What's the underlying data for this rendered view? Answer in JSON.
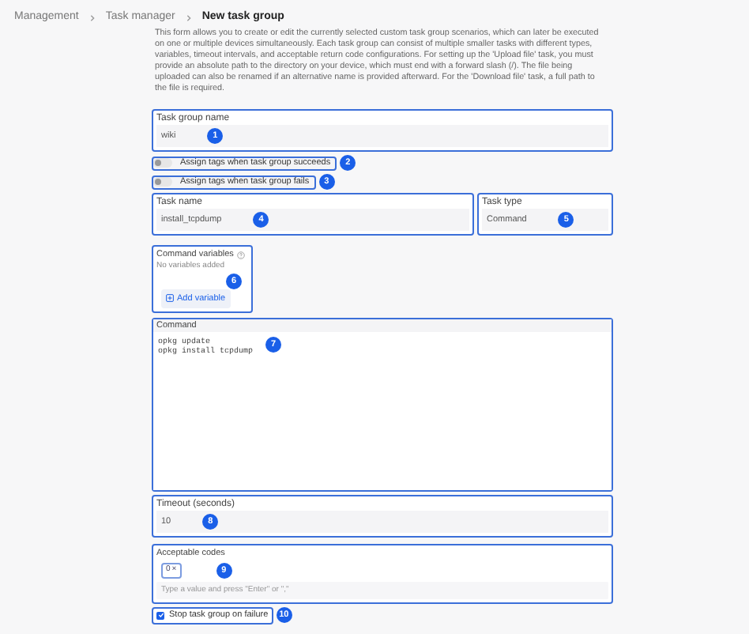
{
  "breadcrumb": [
    {
      "label": "Management",
      "current": false
    },
    {
      "label": "Task manager",
      "current": false
    },
    {
      "label": "New task group",
      "current": true
    }
  ],
  "description": "This form allows you to create or edit the currently selected custom task group scenarios, which can later be executed on one or multiple devices simultaneously. Each task group can consist of multiple smaller tasks with different types, variables, timeout intervals, and acceptable return code configurations. For setting up the 'Upload file' task, you must provide an absolute path to the directory on your device, which must end with a forward slash (/). The file being uploaded can also be renamed if an alternative name is provided afterward. For the 'Download file' task, a full path to the file is required.",
  "rows": [
    [
      {
        "kind": "text",
        "label": "Task group name",
        "value": "wiki",
        "marker": "1"
      }
    ],
    [
      {
        "kind": "toggle",
        "label": "Assign tags when task group succeeds",
        "on": false,
        "marker": "2"
      }
    ],
    [
      {
        "kind": "toggle",
        "label": "Assign tags when task group fails",
        "on": false,
        "marker": "3"
      }
    ],
    [
      {
        "kind": "text",
        "label": "Task name",
        "value": "install_tcpdump",
        "marker": "4"
      },
      {
        "kind": "select",
        "label": "Task type",
        "value": "Command",
        "marker": "5"
      }
    ],
    [
      {
        "kind": "variables",
        "label": "Command variables",
        "empty_text": "No variables added",
        "button": "Add variable",
        "marker": "6"
      }
    ],
    [
      {
        "kind": "code",
        "label": "Command",
        "lines": [
          "opkg update",
          "opkg install tcpdump"
        ],
        "marker": "7"
      }
    ],
    [
      {
        "kind": "text",
        "label": "Timeout (seconds)",
        "value": "10",
        "marker": "8"
      }
    ],
    [
      {
        "kind": "tags",
        "label": "Acceptable codes",
        "tags": [
          {
            "label": "0",
            "remove": "×"
          }
        ],
        "placeholder": "Type a value and press \"Enter\" or \",\"",
        "marker": "9"
      }
    ],
    [
      {
        "kind": "checkbox",
        "label": "Stop task group on failure",
        "checked": true,
        "marker": "10"
      }
    ]
  ]
}
